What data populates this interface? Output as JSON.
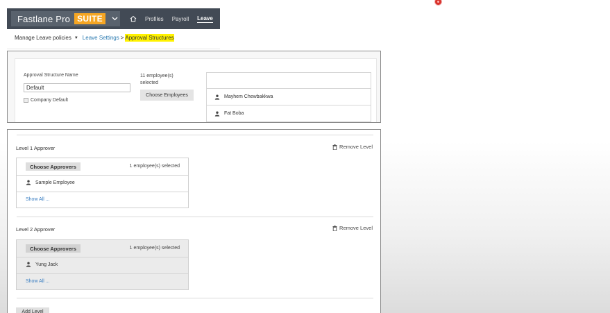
{
  "navbar": {
    "brand": "Fastlane Pro",
    "suite": "SUITE",
    "items": [
      {
        "label": "Profiles"
      },
      {
        "label": "Payroll"
      },
      {
        "label": "Leave"
      }
    ],
    "colors": {
      "bar": "#424a55",
      "suite": "#f6a623"
    }
  },
  "breadcrumb": {
    "root": "Manage Leave policies",
    "settings": "Leave Settings",
    "sep": ">",
    "current": "Approval Structures"
  },
  "structure": {
    "name_label": "Approval Structure Name",
    "name_value": "Default",
    "company_default": "Company Default",
    "selected_count": "11 employee(s) selected",
    "choose_employees": "Choose Employees",
    "employees": [
      "Mayhem Chewbakkwa",
      "Fat Boba"
    ]
  },
  "levels": [
    {
      "title": "Level 1 Approver",
      "remove": "Remove Level",
      "choose": "Choose Approvers",
      "count": "1 employee(s) selected",
      "employee": "Sample Employee",
      "show_all": "Show All ..."
    },
    {
      "title": "Level 2 Approver",
      "remove": "Remove Level",
      "choose": "Choose Approvers",
      "count": "1 employee(s) selected",
      "employee": "Yung Jack",
      "show_all": "Show All ..."
    }
  ],
  "add_level": "Add Level"
}
